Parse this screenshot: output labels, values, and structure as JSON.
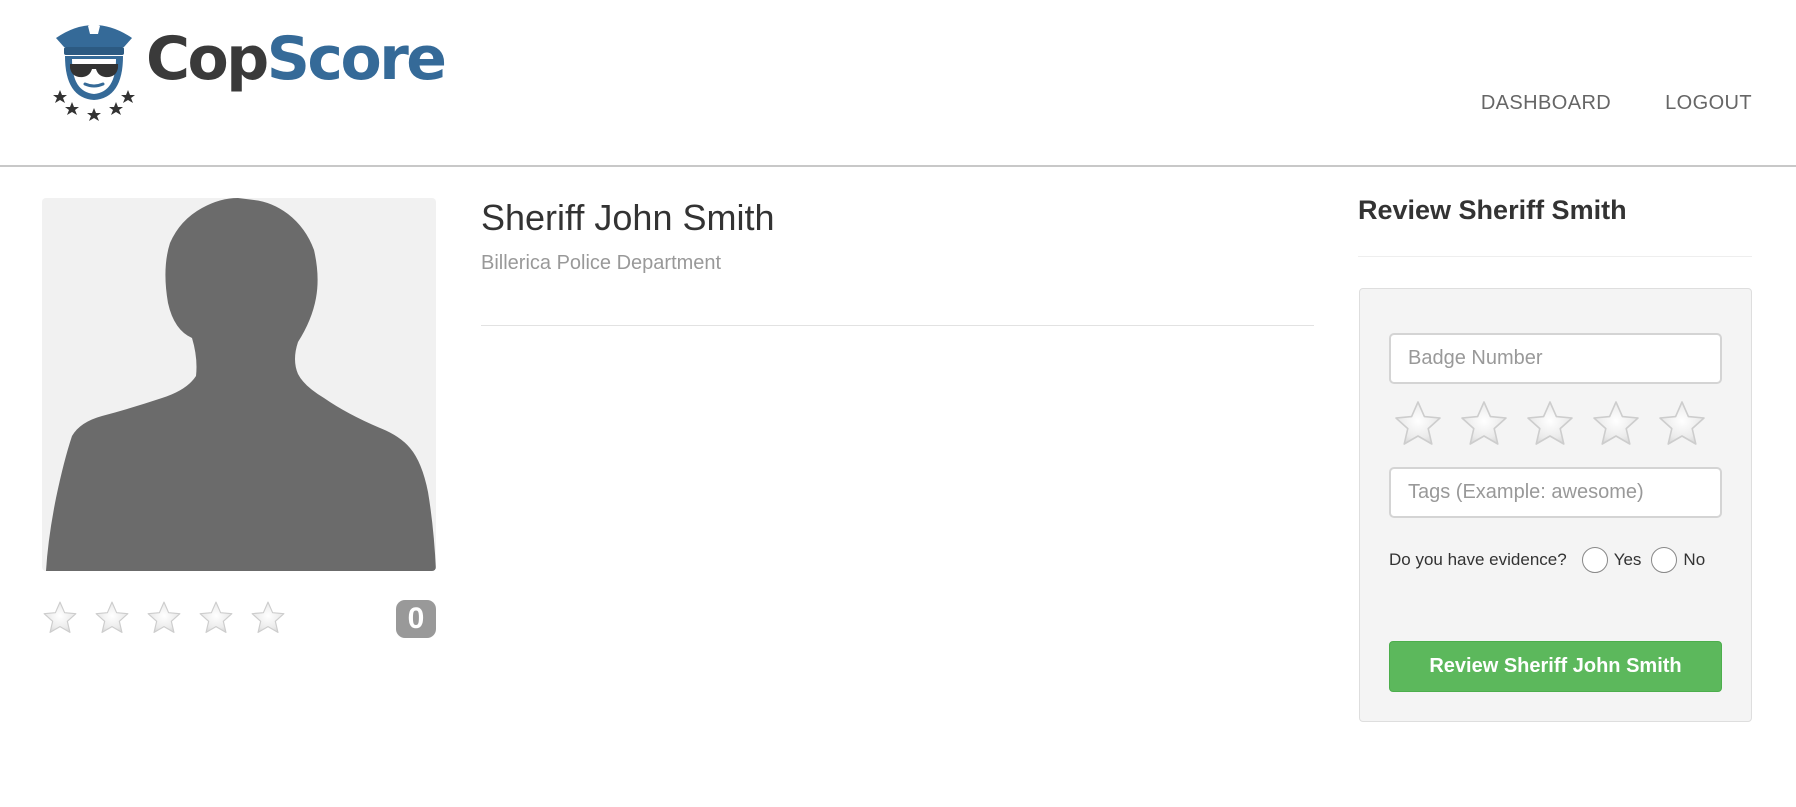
{
  "brand": {
    "name_part1": "Cop",
    "name_part2": "Score",
    "primary_color": "#356a98",
    "dark_color": "#3a3a3a"
  },
  "nav": {
    "items": [
      {
        "label": "DASHBOARD"
      },
      {
        "label": "LOGOUT"
      }
    ]
  },
  "profile": {
    "photo_icon": "person-silhouette-icon",
    "name": "Sheriff John Smith",
    "department": "Billerica Police Department",
    "rating": {
      "stars_filled": 0,
      "stars_total": 5,
      "score": "0"
    }
  },
  "review": {
    "heading": "Review Sheriff Smith",
    "badge_placeholder": "Badge Number",
    "badge_value": "",
    "stars_selected": 0,
    "stars_total": 5,
    "tags_placeholder": "Tags (Example: awesome)",
    "tags_value": "",
    "evidence_question": "Do you have evidence?",
    "evidence_options": [
      {
        "label": "Yes"
      },
      {
        "label": "No"
      }
    ],
    "submit_label": "Review Sheriff John Smith",
    "submit_color": "#5cb85c"
  }
}
